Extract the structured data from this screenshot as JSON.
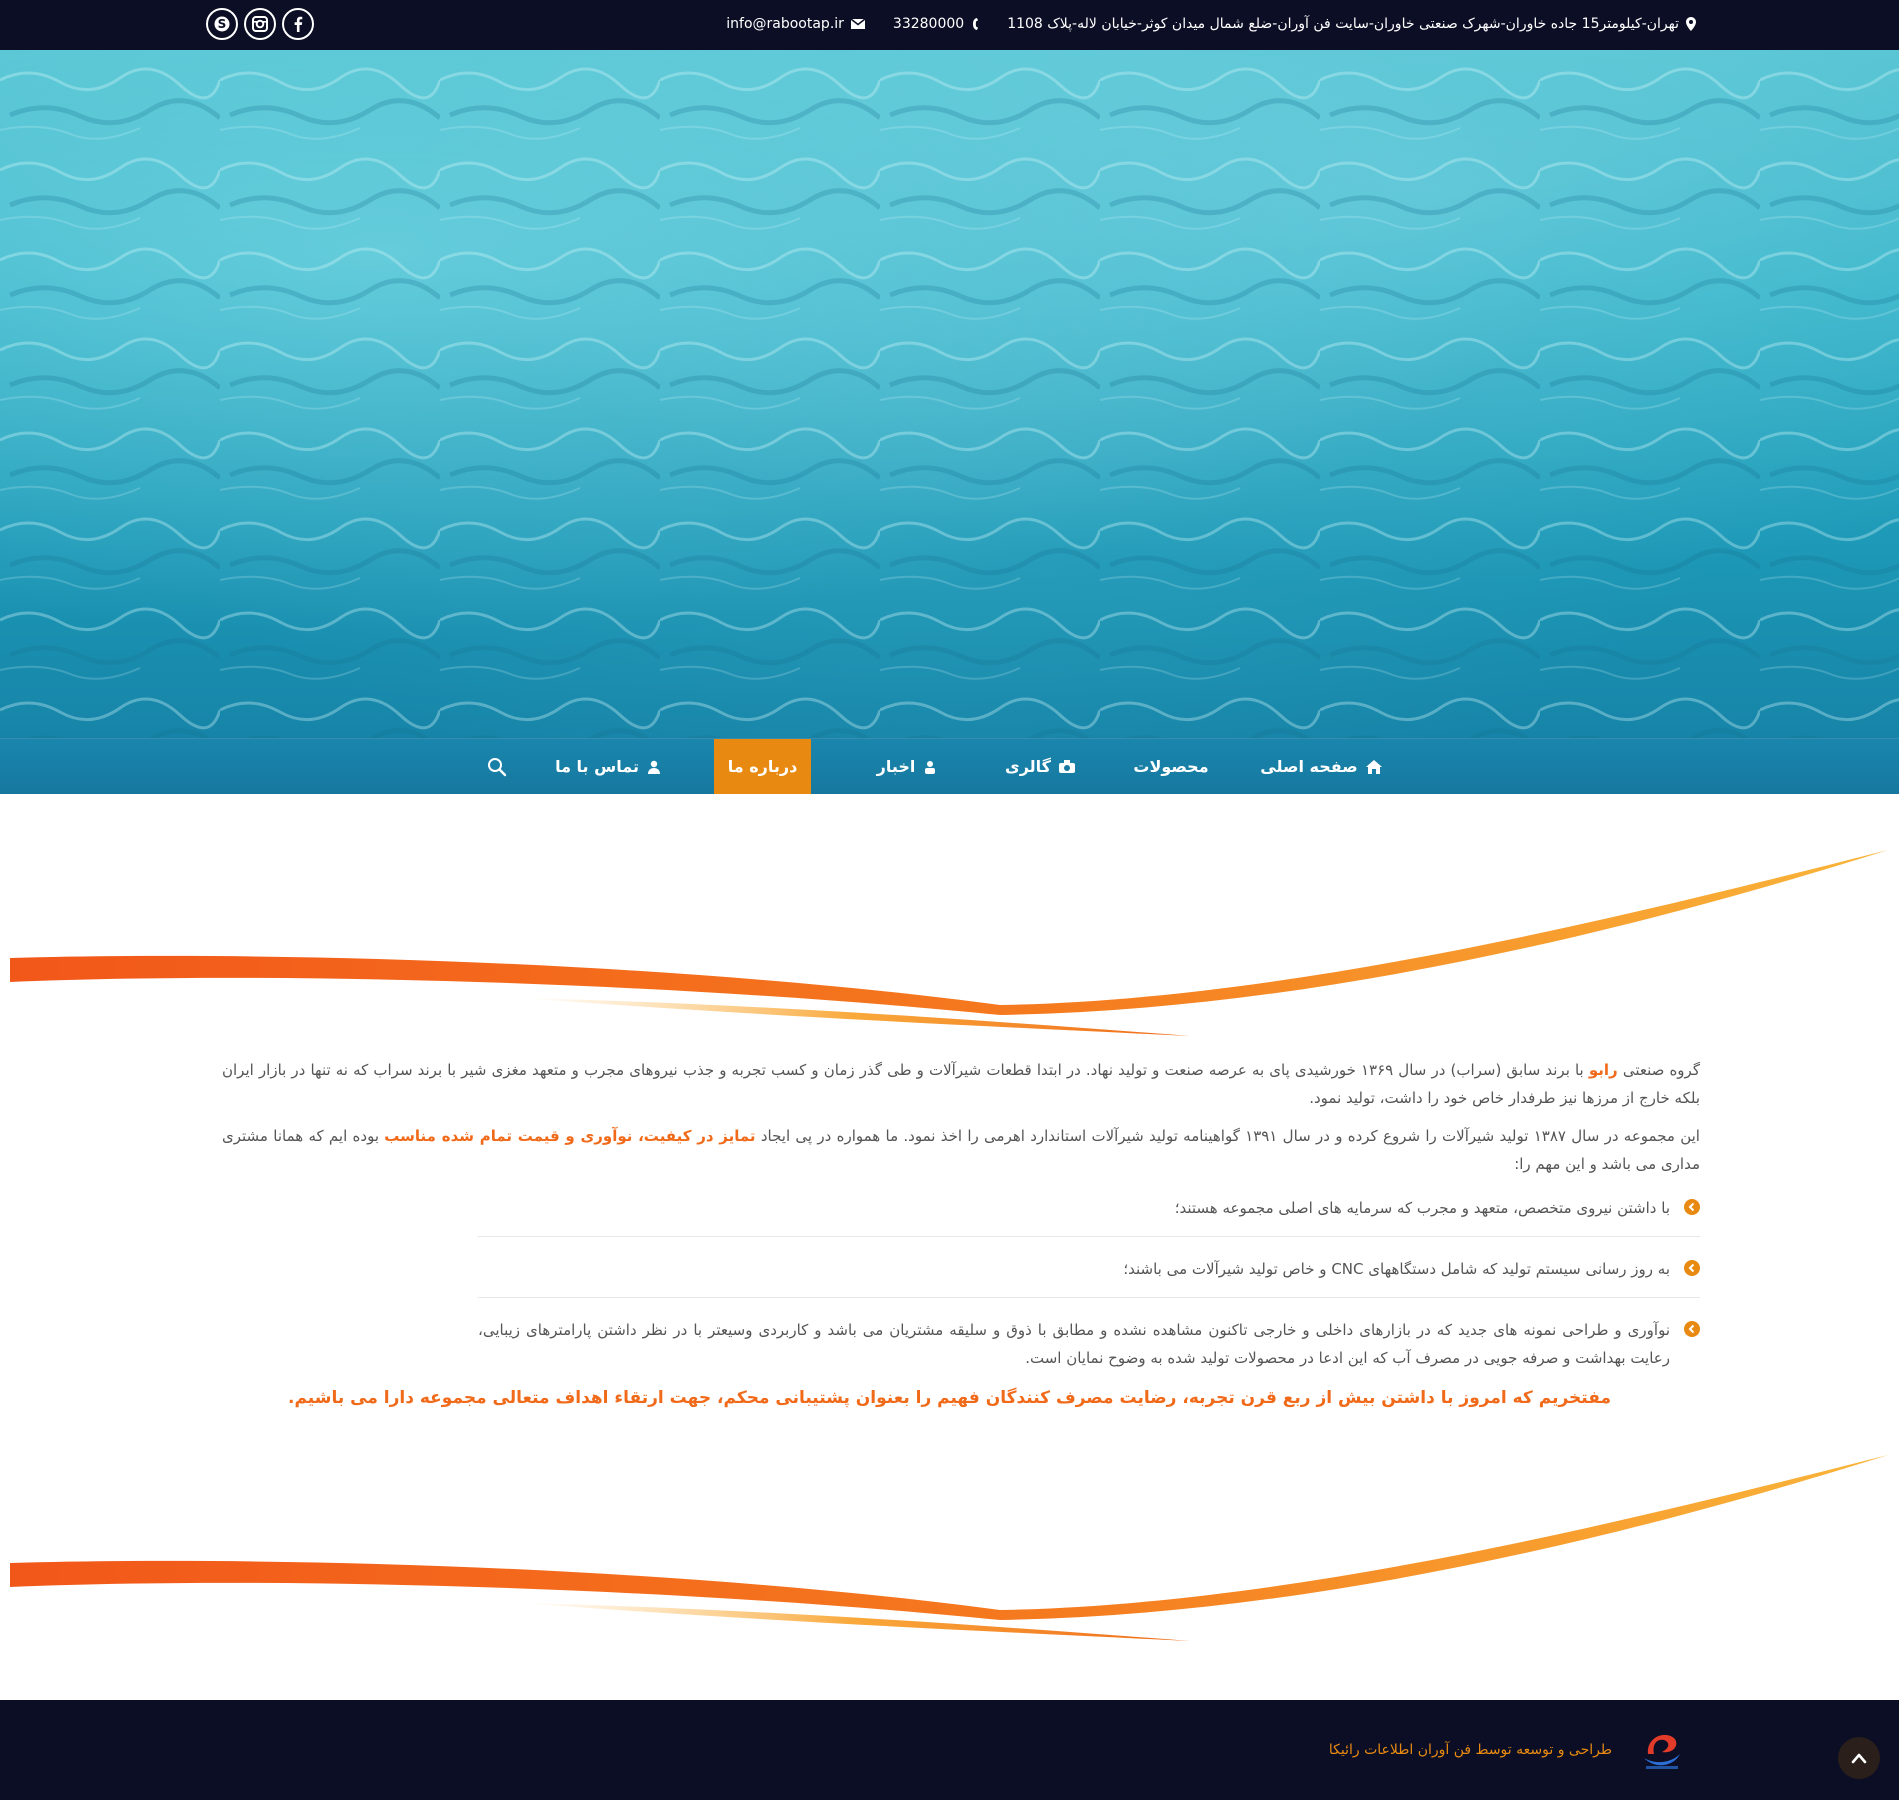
{
  "topbar": {
    "address": "تهران-کیلومتر15 جاده خاوران-شهرک صنعتی خاوران-سایت فن آوران-ضلع شمال میدان کوثر-خیابان لاله-پلاک 1108",
    "phone": "33280000",
    "email": "info@rabootap.ir",
    "social": [
      "skype-icon",
      "instagram-icon",
      "facebook-icon"
    ]
  },
  "nav": {
    "items": [
      {
        "label": "صفحه اصلی",
        "icon": "home-icon"
      },
      {
        "label": "محصولات",
        "icon": ""
      },
      {
        "label": "گالری",
        "icon": "camera-icon"
      },
      {
        "label": "اخبار",
        "icon": "news-icon"
      },
      {
        "label": "درباره ما",
        "icon": "",
        "active": true
      },
      {
        "label": "تماس با ما",
        "icon": "user-icon"
      }
    ],
    "search_icon": "search-icon",
    "active_color": "#e88a12"
  },
  "content": {
    "p1_a": "گروه صنعتی",
    "p1_brand": "رابو",
    "p1_b": "با برند سابق (سراب) در سال ۱۳۶۹ خورشیدی پای به عرصه صنعت و تولید نهاد. در ابتدا قطعات شیرآلات و طی گذر زمان و کسب تجربه و جذب نیروهای مجرب و متعهد مغزی شیر با برند سراب که نه تنها در بازار ایران بلکه خارج از مرزها نیز طرفدار خاص خود را داشت، تولید نمود.",
    "p2_a": "این مجموعه در سال ۱۳۸۷ تولید شیرآلات را شروع کرده و در سال ۱۳۹۱ گواهینامه تولید شیرآلات استاندارد اهرمی را اخذ نمود. ما همواره در پی ایجاد",
    "p2_hl": "تمایز در کیفیت، نوآوری و قیمت تمام شده مناسب",
    "p2_b": "بوده ایم که همانا مشتری مداری می باشد و این مهم را:",
    "list": [
      "با داشتن نیروی متخصص، متعهد و مجرب که سرمایه های اصلی مجموعه هستند؛",
      "به روز رسانی سیستم تولید که شامل دستگاههای CNC و خاص تولید شیرآلات می باشند؛",
      "نوآوری و طراحی نمونه های جدید که در بازارهای داخلی و خارجی تاکنون مشاهده نشده و مطابق با ذوق و سلیقه مشتریان می باشد و کاربردی وسیعتر با در نظر داشتن پارامترهای زیبایی، رعایت بهداشت و صرفه جویی در مصرف آب که این ادعا در محصولات تولید شده به وضوح نمایان است."
    ],
    "slogan": "مفتخریم که امروز با داشتن بیش از ربع قرن تجربه، رضایت مصرف کنندگان فهیم را بعنوان پشتیبانی محکم، جهت ارتقاء اهداف متعالی مجموعه دارا می باشیم.",
    "accent_color": "#f06a1a"
  },
  "footer": {
    "credit": "طراحی و توسعه توسط فن آوران اطلاعات رائیکا",
    "logo_icon": "raika-logo-icon",
    "totop_icon": "chevron-up-icon"
  }
}
